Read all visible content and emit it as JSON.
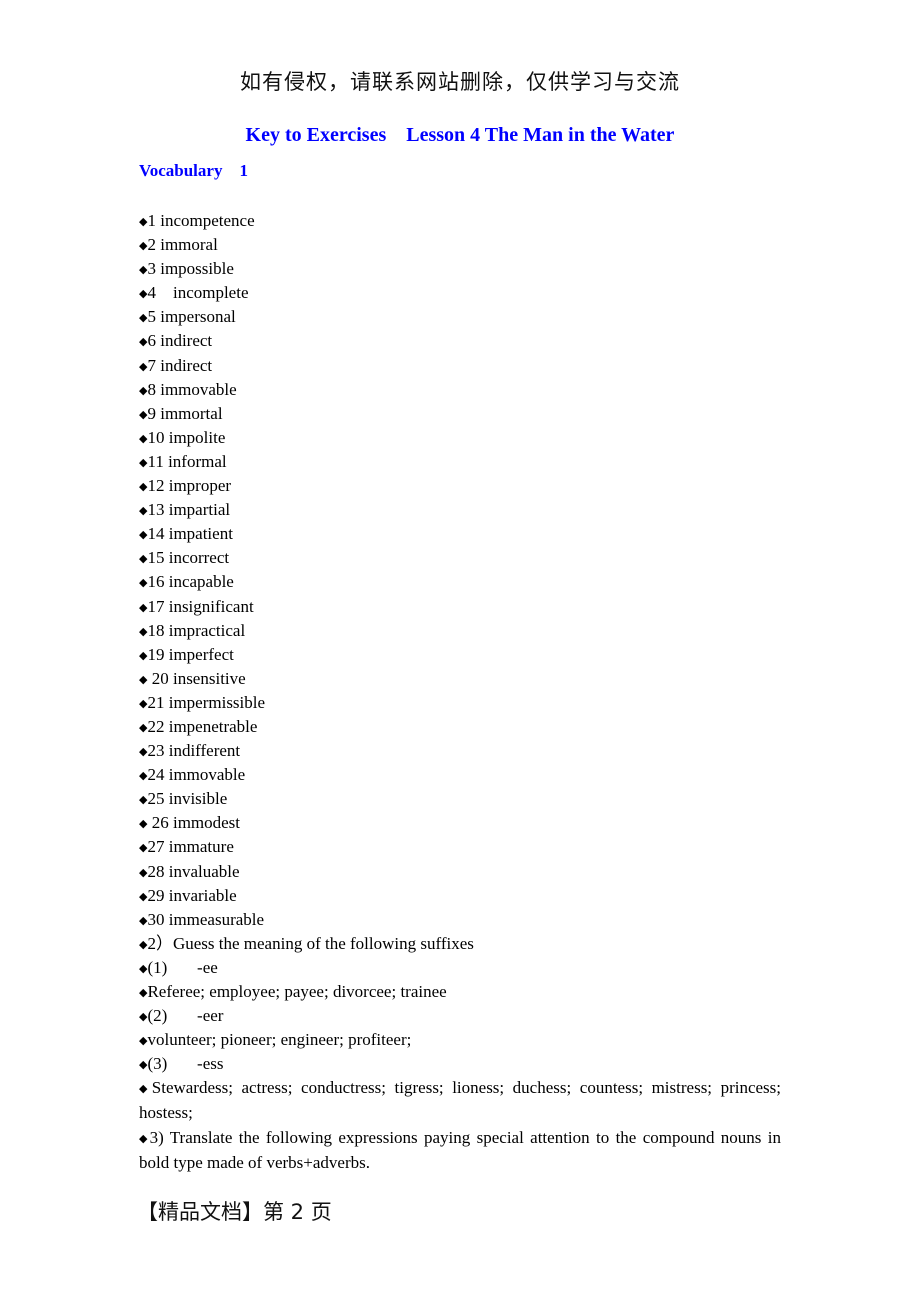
{
  "watermark": "如有侵权，请联系网站删除，仅供学习与交流",
  "title": "Key to Exercises    Lesson 4 The Man in the Water",
  "section_heading": "Vocabulary    1",
  "bullet_icon": "◆",
  "items": [
    "1 incompetence",
    "2 immoral",
    "3 impossible",
    "4    incomplete",
    "5 impersonal",
    "6 indirect",
    "7 indirect",
    "8 immovable",
    "9 immortal",
    "10 impolite",
    "11 informal",
    "12 improper",
    "13 impartial",
    "14 impatient",
    "15 incorrect",
    "16 incapable",
    "17 insignificant",
    "18 impractical",
    "19 imperfect",
    " 20 insensitive",
    "21 impermissible",
    "22 impenetrable",
    "23 indifferent",
    "24 immovable",
    "25 invisible",
    " 26 immodest",
    "27 immature",
    "28 invaluable",
    "29 invariable",
    "30 immeasurable",
    "2）Guess the meaning of the following suffixes",
    "(1)       -ee",
    "Referee; employee; payee; divorcee; trainee",
    "(2)       -eer",
    "volunteer; pioneer; engineer; profiteer;",
    "(3)       -ess",
    "Stewardess; actress; conductress; tigress; lioness; duchess; countess; mistress; princess; hostess;",
    "3) Translate the following expressions paying special attention to the compound nouns in bold type made of verbs+adverbs."
  ],
  "footer": "【精品文档】第 2 页"
}
